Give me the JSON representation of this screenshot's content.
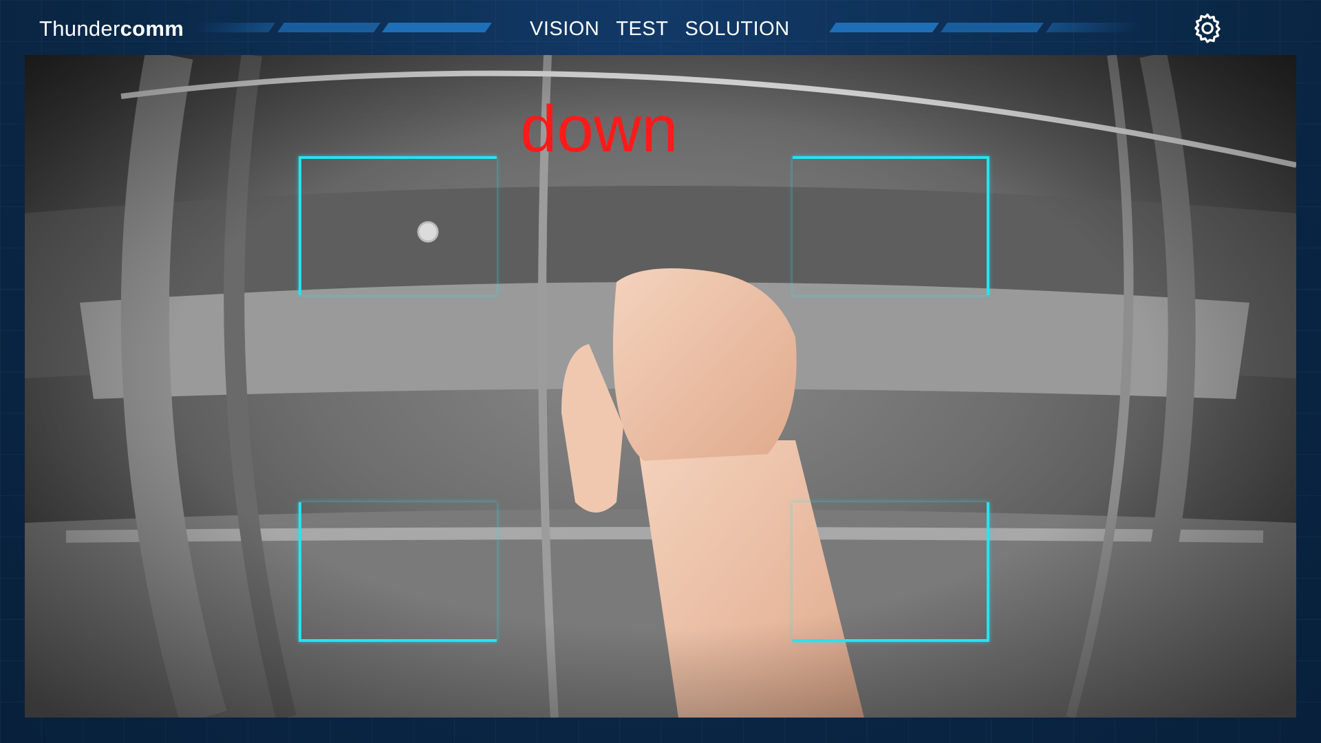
{
  "brand": {
    "part1": "Thunder",
    "part2": "comm"
  },
  "nav": {
    "items": [
      {
        "label": "VISION"
      },
      {
        "label": "TEST"
      },
      {
        "label": "SOLUTION"
      }
    ]
  },
  "settings": {
    "icon": "gear-icon"
  },
  "camera": {
    "gesture_label": "down",
    "frame_color": "#23e4f2",
    "label_color": "#ff1a1a"
  },
  "colors": {
    "background": "#0b2a4f",
    "accent_bar": "#1e6fb8"
  }
}
